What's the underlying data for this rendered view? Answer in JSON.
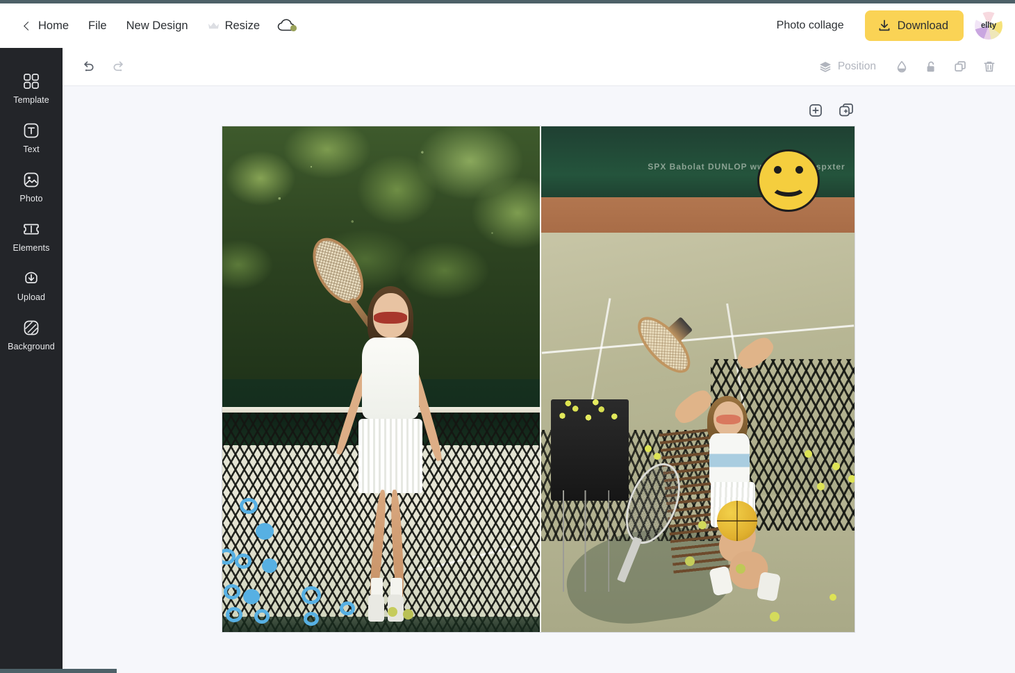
{
  "colors": {
    "accent_yellow": "#fad355",
    "top_strip": "#4d6168",
    "sidebar_bg": "#232529",
    "editor_bg": "#f6f7fb",
    "sticker_yellow": "#f5ce3e",
    "doodle_blue": "#57b0e3"
  },
  "header": {
    "nav": [
      {
        "label": "Home",
        "icon": "chevron-left-icon"
      },
      {
        "label": "File",
        "icon": ""
      },
      {
        "label": "New Design",
        "icon": ""
      },
      {
        "label": "Resize",
        "icon": "crown-icon"
      }
    ],
    "cloud_icon": "cloud-save-icon",
    "document_title": "Photo collage",
    "download_label": "Download",
    "download_icon": "download-icon",
    "avatar_label": "ellty"
  },
  "sidebar": {
    "items": [
      {
        "label": "Template",
        "icon": "template-grid-icon"
      },
      {
        "label": "Text",
        "icon": "text-t-icon"
      },
      {
        "label": "Photo",
        "icon": "photo-image-icon"
      },
      {
        "label": "Elements",
        "icon": "elements-ticket-icon"
      },
      {
        "label": "Upload",
        "icon": "upload-arrow-icon"
      },
      {
        "label": "Background",
        "icon": "background-hatch-icon"
      }
    ]
  },
  "toolbar": {
    "undo_icon": "undo-icon",
    "redo_icon": "redo-icon",
    "position_label": "Position",
    "position_icon": "layers-icon",
    "transparency_icon": "transparency-drop-icon",
    "lock_icon": "unlock-padlock-icon",
    "duplicate_icon": "duplicate-icon",
    "delete_icon": "trash-icon"
  },
  "page_actions": {
    "add_page_icon": "add-page-icon",
    "duplicate_page_icon": "duplicate-page-icon"
  },
  "canvas": {
    "photos": [
      {
        "name": "tennis-player-with-racket-by-net",
        "alt": "Woman in white tennis outfit holding a wooden racket behind her head, standing by a tennis net in front of dark green trees",
        "stickers": [
          "blue-doodle-scribbles"
        ]
      },
      {
        "name": "tennis-player-arms-raised-on-court",
        "alt": "Woman in white tennis skirt and blue-striped crop top leaning back on a chair with arms raised holding a racket, tennis balls and a yellow basketball on the court",
        "stickers": [
          "smiley-face-sticker"
        ],
        "banner_text": "SPX  Babolat  DUNLOP  www.spx.com  spxter"
      }
    ]
  }
}
